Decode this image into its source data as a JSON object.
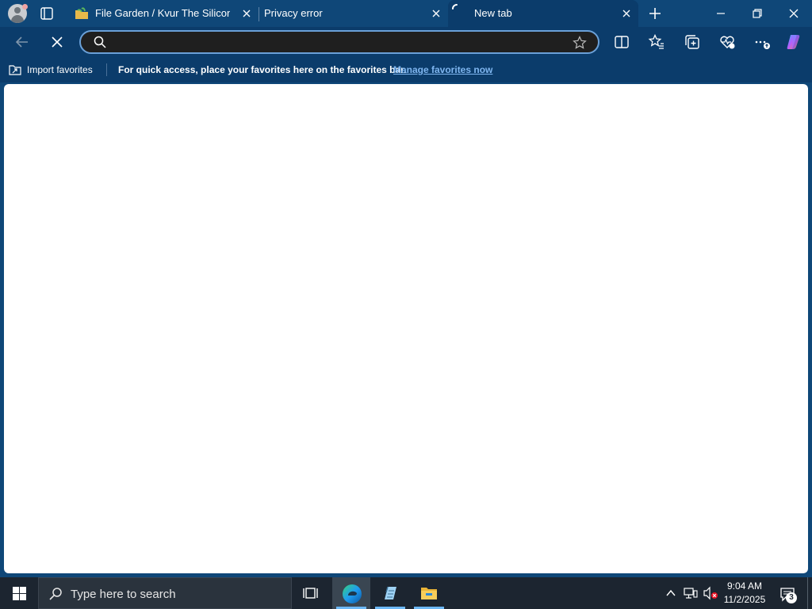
{
  "browser": {
    "tabs": [
      {
        "title": "File Garden / Kvur The Silicon",
        "active": false
      },
      {
        "title": "Privacy error",
        "active": false
      },
      {
        "title": "New tab",
        "active": true,
        "loading": true
      }
    ],
    "address_bar": {
      "value": "",
      "placeholder": ""
    },
    "favorites_bar": {
      "import_label": "Import favorites",
      "message": "For quick access, place your favorites here on the favorites bar.",
      "link": "Manage favorites now"
    },
    "icons": [
      "profile-icon",
      "tab-actions-icon",
      "tab-favicon",
      "loading-spinner-icon",
      "close-icon",
      "plus-icon",
      "minimize-icon",
      "restore-icon",
      "window-close-icon",
      "back-arrow-icon",
      "stop-icon",
      "search-icon",
      "star-icon",
      "split-screen-icon",
      "favorites-icon",
      "collections-icon",
      "performance-icon",
      "more-icon",
      "copilot-icon"
    ],
    "colors": {
      "frame": "#0f4778",
      "toolbar": "#0b3c6b",
      "omnibox_bg": "#1f1f1f",
      "omnibox_border": "#6aa0d8",
      "link": "#7fb6f0",
      "page_bg": "#ffffff"
    }
  },
  "taskbar": {
    "search_placeholder": "Type here to search",
    "time": "9:04 AM",
    "date": "11/2/2025",
    "notification_count": "3",
    "apps": [
      "task-view-icon",
      "edge-icon",
      "notepad-icon",
      "file-explorer-icon"
    ],
    "colors": {
      "bar": "#1c2530",
      "running_indicator": "#6cb8f6"
    }
  }
}
